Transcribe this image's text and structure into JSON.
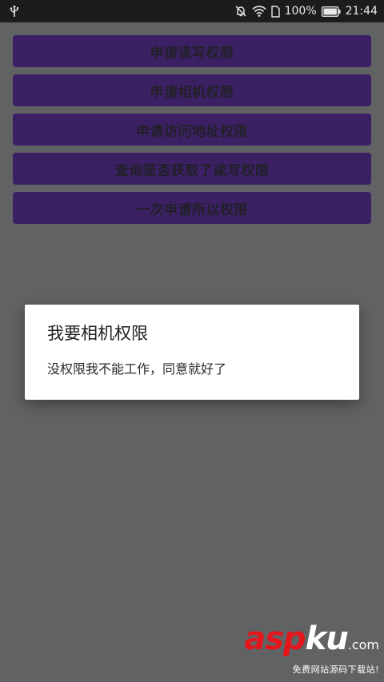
{
  "status_bar": {
    "icons": [
      "usb-icon",
      "mute-icon",
      "wifi-icon",
      "sim-icon",
      "battery-icon"
    ],
    "battery_percent": "100%",
    "time": "21:44"
  },
  "buttons": [
    {
      "label": "申请读写权限"
    },
    {
      "label": "申请相机权限"
    },
    {
      "label": "申请访问地址权限"
    },
    {
      "label": "查询是否获取了读写权限"
    },
    {
      "label": "一次申请所以权限"
    }
  ],
  "dialog": {
    "title": "我要相机权限",
    "message": "没权限我不能工作，同意就好了"
  },
  "watermark": {
    "brand_red": "asp",
    "brand_white": "ku",
    "domain": ".com",
    "tagline": "免费网站源码下载站!"
  },
  "colors": {
    "background": "#616264",
    "status_bar": "#1c1c1d",
    "button": "#3b2064",
    "dialog": "#ffffff",
    "watermark_red": "#e3161c"
  }
}
